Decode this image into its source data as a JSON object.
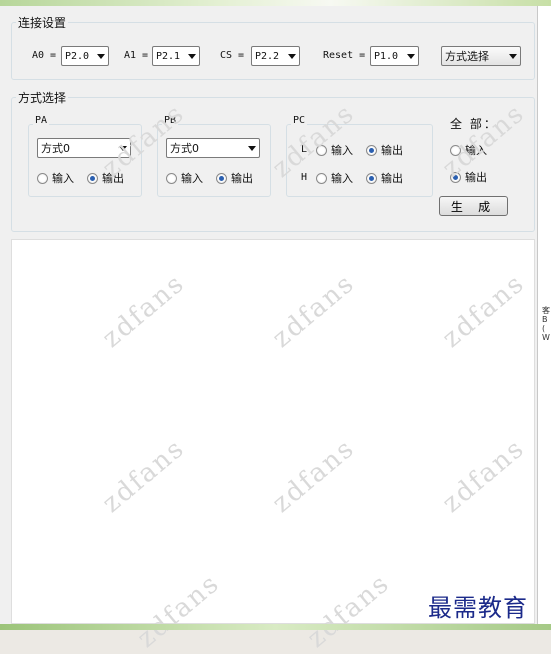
{
  "connection": {
    "title": "连接设置",
    "a0_label": "A0 =",
    "a0_value": "P2.0",
    "a1_label": "A1 =",
    "a1_value": "P2.1",
    "cs_label": "CS =",
    "cs_value": "P2.2",
    "reset_label": "Reset =",
    "reset_value": "P1.0",
    "mode_select": "方式选择"
  },
  "mode": {
    "title": "方式选择",
    "pa": {
      "title": "PA",
      "mode_value": "方式0",
      "input_label": "输入",
      "output_label": "输出",
      "selected": "output"
    },
    "pb": {
      "title": "PB",
      "mode_value": "方式0",
      "input_label": "输入",
      "output_label": "输出",
      "selected": "output"
    },
    "pc": {
      "title": "PC",
      "low_label": "L",
      "high_label": "H",
      "input_label": "输入",
      "output_label": "输出",
      "low_selected": "output",
      "high_selected": "output"
    },
    "all": {
      "title": "全 部：",
      "input_label": "输入",
      "output_label": "输出",
      "selected": "output"
    },
    "generate_button": "生 成"
  },
  "watermark": "zdfans",
  "brand": "最需教育",
  "edge_fragment": "客 B ( W"
}
